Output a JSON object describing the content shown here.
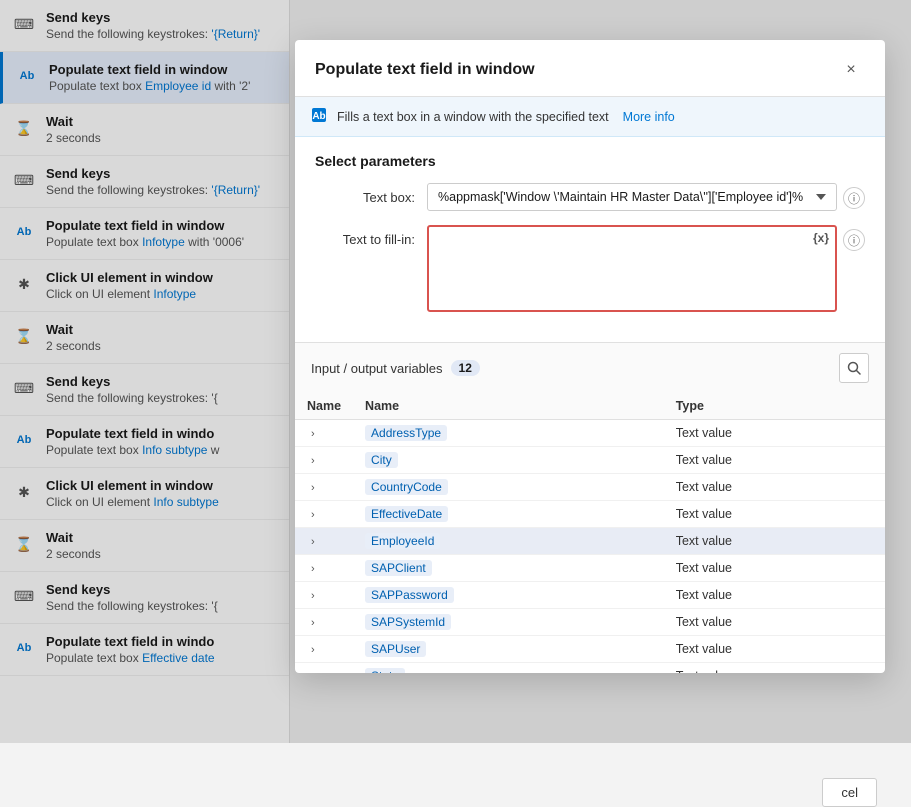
{
  "modal": {
    "title": "Populate text field in window",
    "close_label": "×",
    "info_banner": {
      "text": "Fills a text box in a window with the specified text",
      "more_info_label": "More info"
    },
    "section_title": "Select parameters",
    "textbox_label": "Text box:",
    "textbox_value": "%appmask['Window \\'Maintain HR Master Data\\'']['Employee id']%",
    "text_fill_label": "Text to fill-in:",
    "text_fill_value": "",
    "var_button_label": "{x}",
    "info_button_label": "ⓘ"
  },
  "variables": {
    "section_title": "Input / output variables",
    "count": "12",
    "columns": {
      "name": "Name",
      "type": "Type"
    },
    "items": [
      {
        "name": "AddressType",
        "type": "Text value",
        "highlighted": false
      },
      {
        "name": "City",
        "type": "Text value",
        "highlighted": false
      },
      {
        "name": "CountryCode",
        "type": "Text value",
        "highlighted": false
      },
      {
        "name": "EffectiveDate",
        "type": "Text value",
        "highlighted": false
      },
      {
        "name": "EmployeeId",
        "type": "Text value",
        "highlighted": true
      },
      {
        "name": "SAPClient",
        "type": "Text value",
        "highlighted": false
      },
      {
        "name": "SAPPassword",
        "type": "Text value",
        "highlighted": false
      },
      {
        "name": "SAPSystemId",
        "type": "Text value",
        "highlighted": false
      },
      {
        "name": "SAPUser",
        "type": "Text value",
        "highlighted": false
      },
      {
        "name": "State",
        "type": "Text value",
        "highlighted": false
      }
    ]
  },
  "workflow": {
    "items": [
      {
        "icon": "⌨",
        "title": "Send keys",
        "subtitle": "Send the following keystrokes: '{Return}'"
      },
      {
        "icon": "Ab",
        "title": "Populate text field in window",
        "subtitle": "Populate text box Employee id with '2'",
        "active": true
      },
      {
        "icon": "⌛",
        "title": "Wait",
        "subtitle": "2 seconds"
      },
      {
        "icon": "⌨",
        "title": "Send keys",
        "subtitle": "Send the following keystrokes: '{Return}'"
      },
      {
        "icon": "Ab",
        "title": "Populate text field in window",
        "subtitle": "Populate text box Infotype with '0006'"
      },
      {
        "icon": "✱",
        "title": "Click UI element in window",
        "subtitle": "Click on UI element Infotype"
      },
      {
        "icon": "⌛",
        "title": "Wait",
        "subtitle": "2 seconds"
      },
      {
        "icon": "⌨",
        "title": "Send keys",
        "subtitle": "Send the following keystrokes: '{"
      },
      {
        "icon": "Ab",
        "title": "Populate text field in windo",
        "subtitle": "Populate text box Info subtype w"
      },
      {
        "icon": "✱",
        "title": "Click UI element in window",
        "subtitle": "Click on UI element Info subtype"
      },
      {
        "icon": "⌛",
        "title": "Wait",
        "subtitle": "2 seconds"
      },
      {
        "icon": "⌨",
        "title": "Send keys",
        "subtitle": "Send the following keystrokes: '{"
      },
      {
        "icon": "Ab",
        "title": "Populate text field in windo",
        "subtitle": "Populate text box Effective date"
      }
    ]
  },
  "cancel_label": "cel"
}
